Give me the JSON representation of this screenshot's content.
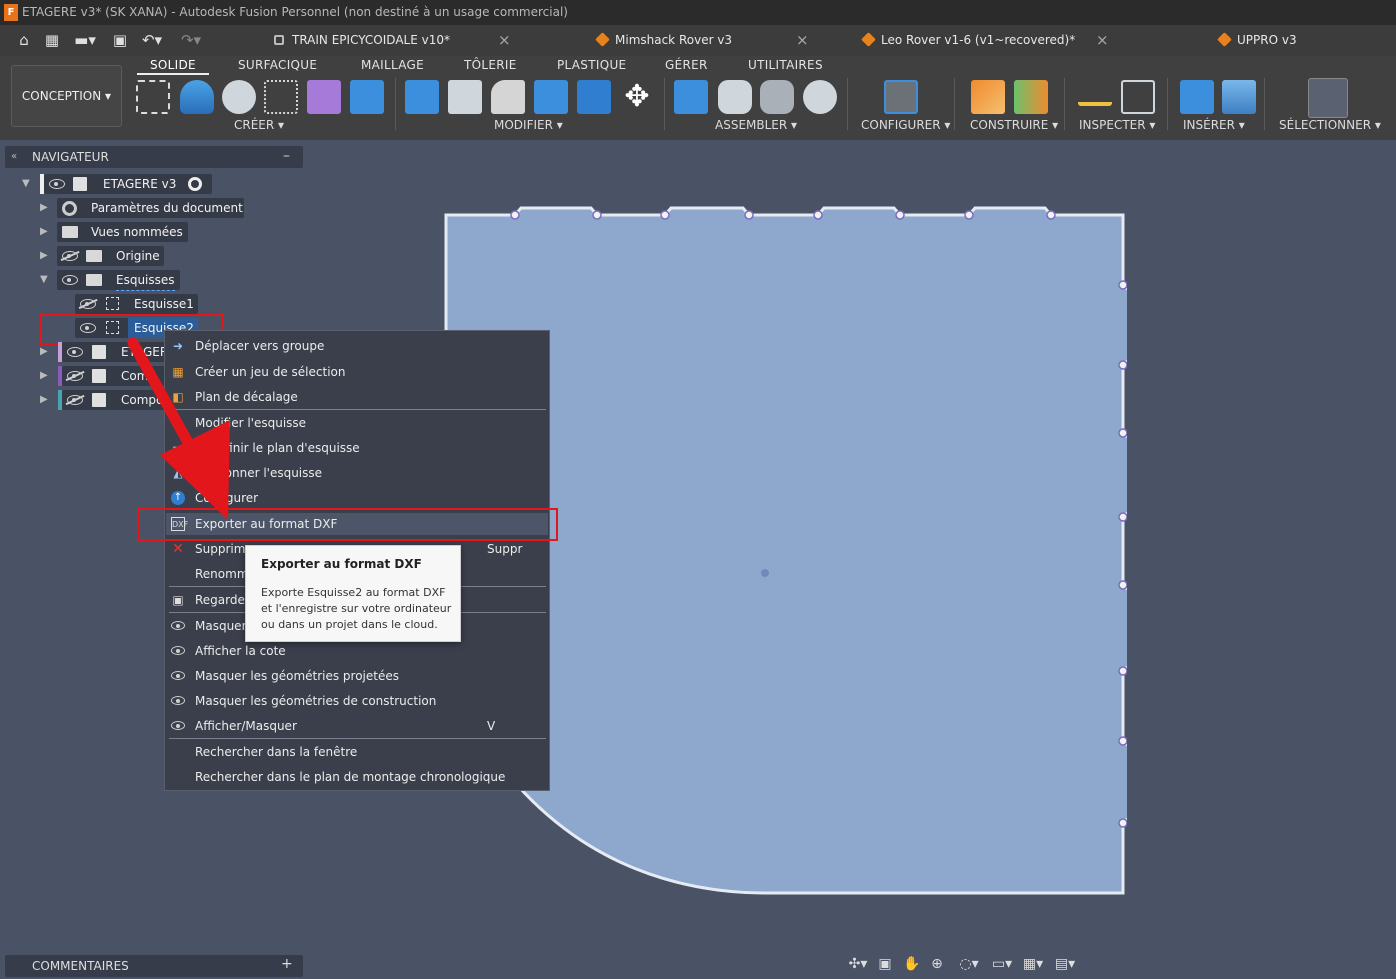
{
  "window": {
    "app_icon": "F",
    "title": "ETAGERE v3* (SK XANA) - Autodesk Fusion Personnel (non destiné à un usage commercial)"
  },
  "quick_access": {
    "icons": [
      "home-icon",
      "grid-icon",
      "file-icon",
      "save-icon",
      "undo-icon",
      "redo-icon"
    ]
  },
  "doc_tabs": [
    {
      "label": "TRAIN EPICYCOIDALE v10*",
      "icon": "lock-icon",
      "close": "×"
    },
    {
      "label": "Mimshack Rover v3",
      "icon": "component-icon",
      "close": "×"
    },
    {
      "label": "Leo Rover v1-6 (v1~recovered)*",
      "icon": "component-icon",
      "close": "×"
    },
    {
      "label": "UPPRO v3",
      "icon": "component-icon"
    }
  ],
  "toolbar": {
    "workspace": "CONCEPTION ▾",
    "tabs": [
      "SOLIDE",
      "SURFACIQUE",
      "MAILLAGE",
      "TÔLERIE",
      "PLASTIQUE",
      "GÉRER",
      "UTILITAIRES"
    ],
    "active_tab": "SOLIDE",
    "groups": [
      "CRÉER ▾",
      "MODIFIER ▾",
      "ASSEMBLER ▾",
      "CONFIGURER ▾",
      "CONSTRUIRE ▾",
      "INSPECTER ▾",
      "INSÉRER ▾",
      "SÉLECTIONNER ▾"
    ]
  },
  "navigator": {
    "title": "NAVIGATEUR",
    "collapse": "–",
    "root": "ETAGERE v3",
    "items": [
      "Paramètres du document",
      "Vues nommées",
      "Origine",
      "Esquisses",
      "Esquisse1",
      "Esquisse2",
      "ETAGER",
      "Com",
      "Compo"
    ]
  },
  "context_menu": {
    "items": [
      {
        "label": "Déplacer vers groupe",
        "icon": "move-to-group-icon"
      },
      {
        "label": "Créer un jeu de sélection",
        "icon": "selection-set-icon"
      },
      {
        "label": "Plan de décalage",
        "icon": "offset-plane-icon"
      },
      {
        "label": "Modifier l'esquisse",
        "icon": "edit-sketch-icon"
      },
      {
        "label": "Redéfinir le plan d'esquisse",
        "icon": "redefine-plane-icon"
      },
      {
        "label": "Sectionner l'esquisse",
        "icon": "slice-sketch-icon"
      },
      {
        "label": "Configurer",
        "icon": "configure-icon"
      },
      {
        "label": "Exporter au format DXF",
        "icon": "dxf-icon"
      },
      {
        "label": "Supprimer",
        "icon": "delete-icon",
        "shortcut": "Suppr"
      },
      {
        "label": "Renommer",
        "icon": ""
      },
      {
        "label": "Regarder",
        "icon": "look-at-icon"
      },
      {
        "label": "Masquer",
        "icon": "eye-icon"
      },
      {
        "label": "Afficher la cote",
        "icon": "eye-icon"
      },
      {
        "label": "Masquer les géométries projetées",
        "icon": "eye-icon"
      },
      {
        "label": "Masquer les géométries de construction",
        "icon": "eye-icon"
      },
      {
        "label": "Afficher/Masquer",
        "icon": "eye-icon",
        "shortcut": "V"
      },
      {
        "label": "Rechercher dans la fenêtre",
        "icon": ""
      },
      {
        "label": "Rechercher dans le plan de montage chronologique",
        "icon": ""
      }
    ]
  },
  "tooltip": {
    "title": "Exporter au format DXF",
    "body": "Exporte Esquisse2 au format DXF et l'enregistre sur votre ordinateur ou dans un projet dans le cloud."
  },
  "comments": {
    "title": "COMMENTAIRES",
    "add": "+"
  },
  "colors": {
    "panel_fill": "#8ea7cc",
    "annotation": "#e3161b",
    "background": "#4a5366"
  }
}
